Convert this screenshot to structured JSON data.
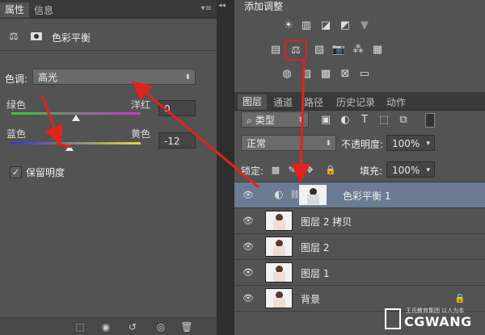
{
  "left_panel": {
    "tabs": [
      "属性",
      "信息"
    ],
    "title": "色彩平衡",
    "tone_label": "色调:",
    "tone_value": "高光",
    "sliders": [
      {
        "left": "绿色",
        "right": "洋红",
        "value": "0",
        "position": 0.5
      },
      {
        "left": "蓝色",
        "right": "黄色",
        "value": "-12",
        "position": 0.45
      }
    ],
    "preserve_luminosity": "保留明度",
    "preserve_checked": true
  },
  "right_panel": {
    "adjust_title": "添加调整",
    "layer_tabs": [
      "图层",
      "通道",
      "路径",
      "历史记录",
      "动作"
    ],
    "filter_kind": "类型",
    "blend_mode": "正常",
    "opacity_label": "不透明度:",
    "opacity_value": "100%",
    "lock_label": "锁定:",
    "fill_label": "填充:",
    "fill_value": "100%",
    "layers": [
      {
        "name": "色彩平衡 1",
        "selected": true,
        "adjustment": true
      },
      {
        "name": "图层 2 拷贝",
        "selected": false
      },
      {
        "name": "图层 2",
        "selected": false
      },
      {
        "name": "图层 1",
        "selected": false
      },
      {
        "name": "背景",
        "selected": false,
        "locked": true
      }
    ]
  },
  "watermark": {
    "brand": "CGWANG",
    "sub": "王氏教育集团 以人为本"
  },
  "colors": {
    "annotation": "#e0241b",
    "selection": "#6b7b93",
    "panel": "#535353"
  }
}
